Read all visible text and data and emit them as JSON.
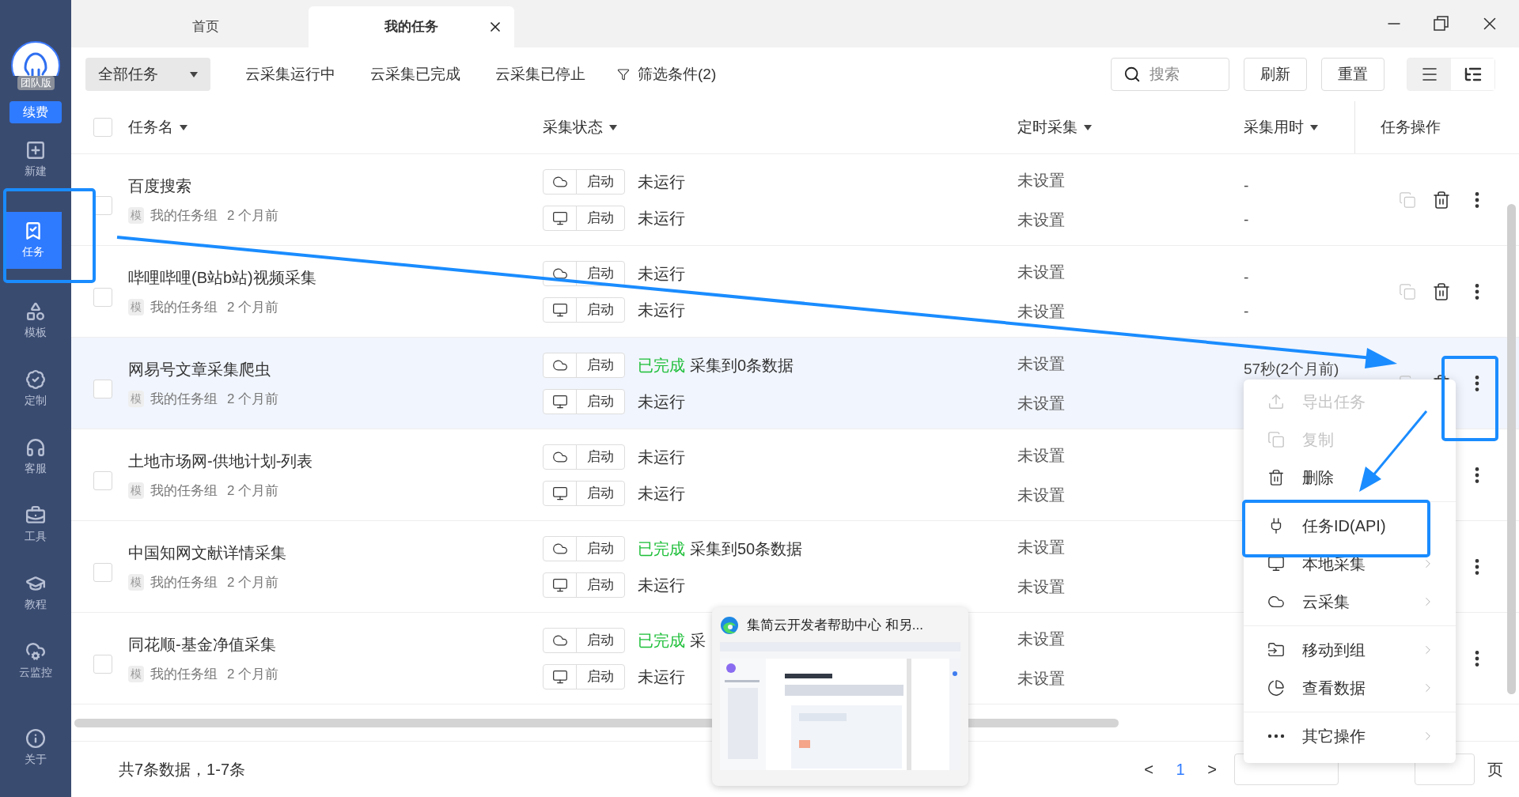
{
  "sidebar": {
    "edition": "团队版",
    "renew": "续费",
    "items": [
      {
        "label": "新建",
        "selected": false
      },
      {
        "label": "任务",
        "selected": true
      },
      {
        "label": "模板",
        "selected": false
      },
      {
        "label": "定制",
        "selected": false
      },
      {
        "label": "客服",
        "selected": false
      },
      {
        "label": "工具",
        "selected": false
      },
      {
        "label": "教程",
        "selected": false
      },
      {
        "label": "云监控",
        "selected": false
      },
      {
        "label": "关于",
        "selected": false
      }
    ]
  },
  "tabs": [
    {
      "label": "首页",
      "selected": false
    },
    {
      "label": "我的任务",
      "selected": true
    }
  ],
  "toolbar": {
    "dropdown": "全部任务",
    "filters": [
      "云采集运行中",
      "云采集已完成",
      "云采集已停止"
    ],
    "filter_conditions": "筛选条件(2)",
    "search": {
      "placeholder": "搜索"
    },
    "buttons": [
      "刷新",
      "重置"
    ],
    "views": [
      {
        "kind": "list",
        "selected": true
      },
      {
        "kind": "tree",
        "selected": false
      }
    ]
  },
  "table": {
    "select_all": {
      "checked": false
    },
    "columns": [
      "任务名",
      "采集状态",
      "定时采集",
      "采集用时",
      "任务操作"
    ],
    "rows": [
      {
        "name": "百度搜索",
        "tag": "模",
        "group": "我的任务组",
        "time": "2 个月前",
        "checked": false,
        "hovered": false,
        "runs": [
          {
            "kind": "cloud",
            "button": "启动",
            "status": "未运行",
            "done": false
          },
          {
            "kind": "local",
            "button": "启动",
            "status": "未运行",
            "done": false
          }
        ],
        "schedule": [
          "未设置",
          "未设置"
        ],
        "duration": [
          "-",
          "-"
        ],
        "actions": [
          {
            "kind": "copy"
          },
          {
            "kind": "delete"
          },
          {
            "kind": "more"
          }
        ]
      },
      {
        "name": "哔哩哔哩(B站b站)视频采集",
        "tag": "模",
        "group": "我的任务组",
        "time": "2 个月前",
        "checked": false,
        "hovered": false,
        "runs": [
          {
            "kind": "cloud",
            "button": "启动",
            "status": "未运行",
            "done": false
          },
          {
            "kind": "local",
            "button": "启动",
            "status": "未运行",
            "done": false
          }
        ],
        "schedule": [
          "未设置",
          "未设置"
        ],
        "duration": [
          "-",
          "-"
        ],
        "actions": [
          {
            "kind": "copy"
          },
          {
            "kind": "delete"
          },
          {
            "kind": "more"
          }
        ]
      },
      {
        "name": "网易号文章采集爬虫",
        "tag": "模",
        "group": "我的任务组",
        "time": "2 个月前",
        "checked": false,
        "hovered": true,
        "runs": [
          {
            "kind": "cloud",
            "button": "启动",
            "status": "已完成",
            "done": true,
            "detail": "采集到0条数据"
          },
          {
            "kind": "local",
            "button": "启动",
            "status": "未运行",
            "done": false
          }
        ],
        "schedule": [
          "未设置",
          "未设置"
        ],
        "duration": [
          "57秒(2个月前)"
        ],
        "actions": [
          {
            "kind": "copy"
          },
          {
            "kind": "delete"
          },
          {
            "kind": "more"
          }
        ]
      },
      {
        "name": "土地市场网-供地计划-列表",
        "tag": "模",
        "group": "我的任务组",
        "time": "2 个月前",
        "checked": false,
        "hovered": false,
        "runs": [
          {
            "kind": "cloud",
            "button": "启动",
            "status": "未运行",
            "done": false
          },
          {
            "kind": "local",
            "button": "启动",
            "status": "未运行",
            "done": false
          }
        ],
        "schedule": [
          "未设置",
          "未设置"
        ],
        "actions": [
          {
            "kind": "more"
          }
        ]
      },
      {
        "name": "中国知网文献详情采集",
        "tag": "模",
        "group": "我的任务组",
        "time": "2 个月前",
        "checked": false,
        "hovered": false,
        "runs": [
          {
            "kind": "cloud",
            "button": "启动",
            "status": "已完成",
            "done": true,
            "detail": "采集到50条数据"
          },
          {
            "kind": "local",
            "button": "启动",
            "status": "未运行",
            "done": false
          }
        ],
        "schedule": [
          "未设置",
          "未设置"
        ],
        "actions": [
          {
            "kind": "more"
          }
        ]
      },
      {
        "name": "同花顺-基金净值采集",
        "tag": "模",
        "group": "我的任务组",
        "time": "2 个月前",
        "checked": false,
        "hovered": false,
        "runs": [
          {
            "kind": "cloud",
            "button": "启动",
            "status": "已完成",
            "done": true,
            "detail": "采"
          },
          {
            "kind": "local",
            "button": "启动",
            "status": "未运行",
            "done": false
          }
        ],
        "schedule": [
          "未设置",
          "未设置"
        ],
        "actions": [
          {
            "kind": "more"
          }
        ]
      }
    ]
  },
  "footer": {
    "summary": "共7条数据，1-7条",
    "prev": "<",
    "pages": [
      {
        "label": "1",
        "selected": true
      }
    ],
    "next": ">",
    "page_unit": "页"
  },
  "context_menu": {
    "groups": [
      [
        {
          "kind": "export",
          "label": "导出任务",
          "disabled": true,
          "submenu": false
        },
        {
          "kind": "copy",
          "label": "复制",
          "disabled": true,
          "submenu": false
        },
        {
          "kind": "delete",
          "label": "删除",
          "disabled": false,
          "submenu": false
        }
      ],
      [
        {
          "kind": "api",
          "label": "任务ID(API)",
          "disabled": false,
          "submenu": false
        },
        {
          "kind": "local",
          "label": "本地采集",
          "disabled": false,
          "submenu": true
        },
        {
          "kind": "cloud",
          "label": "云采集",
          "disabled": false,
          "submenu": true
        }
      ],
      [
        {
          "kind": "move",
          "label": "移动到组",
          "disabled": false,
          "submenu": true
        },
        {
          "kind": "data",
          "label": "查看数据",
          "disabled": false,
          "submenu": true
        }
      ],
      [
        {
          "kind": "more",
          "label": "其它操作",
          "disabled": false,
          "submenu": true
        }
      ]
    ]
  },
  "preview": {
    "title": "集简云开发者帮助中心  和另...",
    "kind": "picture"
  }
}
